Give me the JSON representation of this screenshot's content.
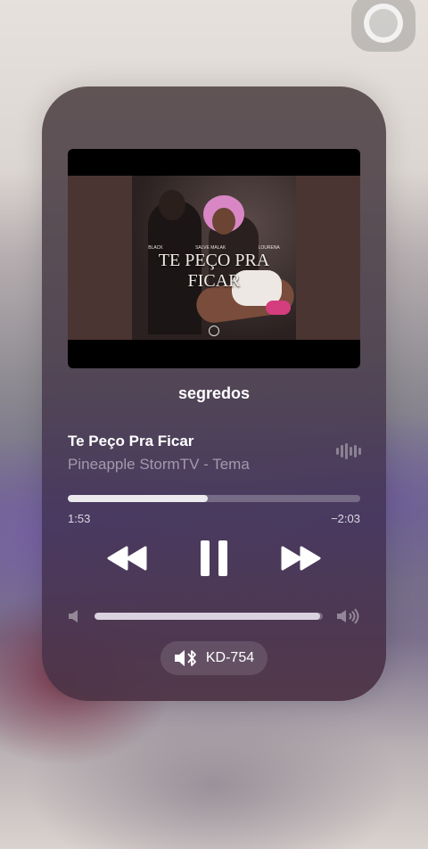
{
  "now_playing": {
    "airplay_title": "segredos",
    "song_title": "Te Peço Pra Ficar",
    "song_subtitle": "Pineapple StormTV - Tema",
    "progress_fraction": 0.48,
    "elapsed_time": "1:53",
    "remaining_time": "−2:03",
    "volume_fraction": 0.99,
    "output_device": "KD-754"
  },
  "cover_art": {
    "title": "TE PEÇO PRA FICAR",
    "artists": [
      "BLACK",
      "SALVE MALAK",
      "LOURENA"
    ]
  },
  "colors": {
    "card_bg": "#4f4450",
    "accent_pink": "#d987c4",
    "shoe_pink": "#d43d7e"
  },
  "icons": {
    "assistive_touch": "assistive-touch-icon",
    "waveform": "waveform-icon",
    "rewind": "rewind-icon",
    "pause": "pause-icon",
    "fast_forward": "fast-forward-icon",
    "volume_low": "volume-low-icon",
    "volume_high": "volume-high-icon",
    "bluetooth_speaker": "bluetooth-speaker-icon"
  }
}
